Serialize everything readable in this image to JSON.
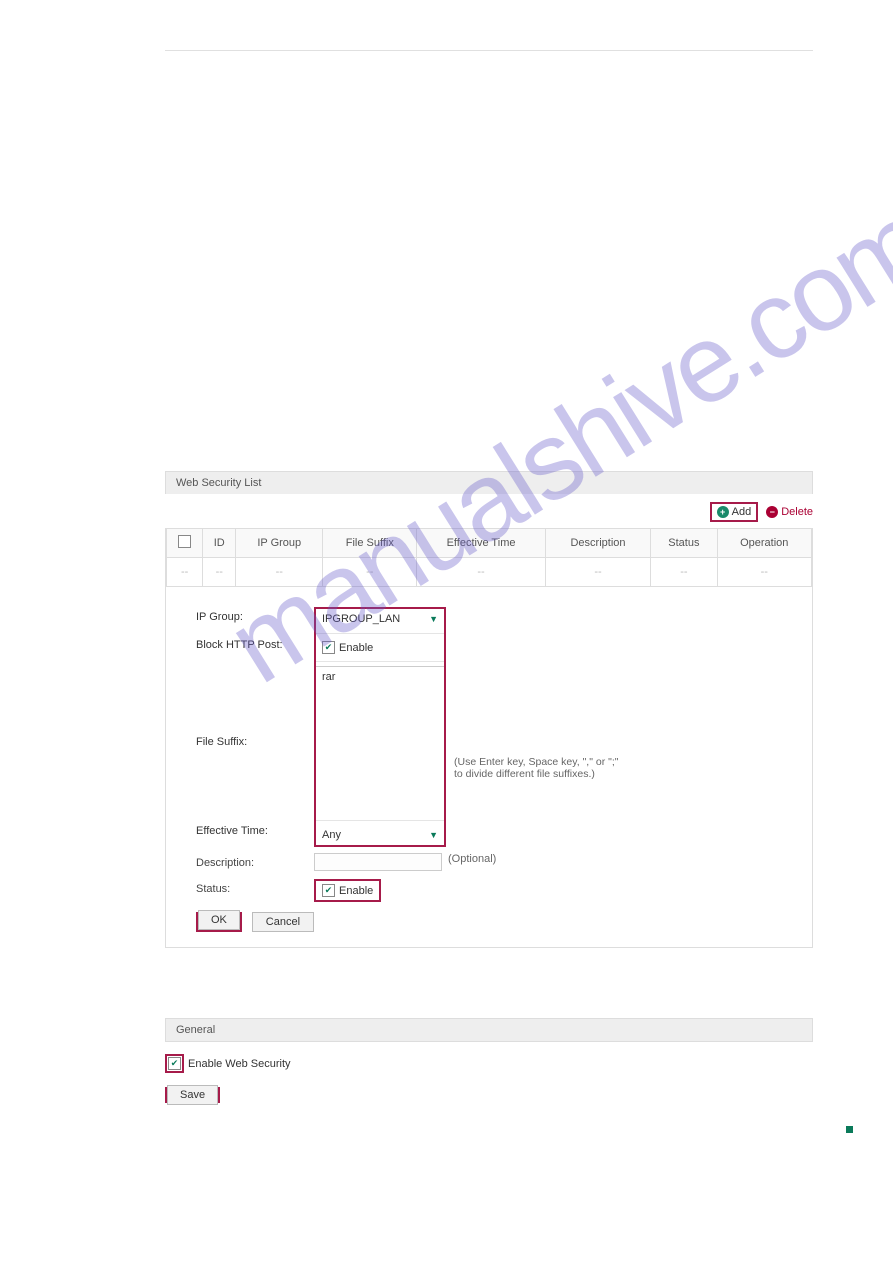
{
  "watermark_text": "manualshive.com",
  "web_security": {
    "panel_title": "Web Security List",
    "toolbar": {
      "add_label": "Add",
      "delete_label": "Delete"
    },
    "table": {
      "headers": [
        "ID",
        "IP Group",
        "File Suffix",
        "Effective Time",
        "Description",
        "Status",
        "Operation"
      ],
      "empty_cell": "--"
    },
    "form": {
      "ip_group_label": "IP Group:",
      "ip_group_value": "IPGROUP_LAN",
      "block_http_label": "Block HTTP Post:",
      "block_http_enable": "Enable",
      "file_suffix_label": "File Suffix:",
      "file_suffix_value": "rar",
      "file_suffix_hint": "(Use Enter key, Space key, \",\" or \";\" to divide different file suffixes.)",
      "effective_time_label": "Effective Time:",
      "effective_time_value": "Any",
      "description_label": "Description:",
      "description_optional": "(Optional)",
      "status_label": "Status:",
      "status_enable": "Enable",
      "ok_label": "OK",
      "cancel_label": "Cancel"
    }
  },
  "general": {
    "panel_title": "General",
    "enable_label": "Enable Web Security",
    "save_label": "Save"
  }
}
